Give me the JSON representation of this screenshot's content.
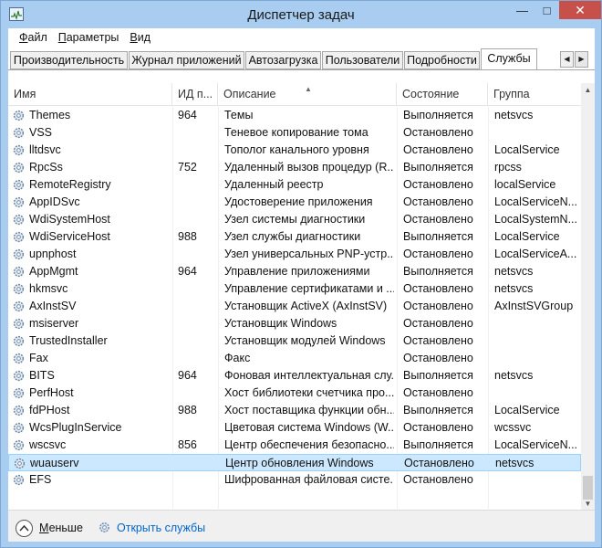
{
  "window": {
    "title": "Диспетчер задач",
    "controls": {
      "minimize": "—",
      "maximize": "□",
      "close": "✕"
    }
  },
  "menu": [
    {
      "u": "Ф",
      "rest": "айл"
    },
    {
      "u": "П",
      "rest": "араметры"
    },
    {
      "u": "В",
      "rest": "ид"
    }
  ],
  "tabs": [
    "Производительность",
    "Журнал приложений",
    "Автозагрузка",
    "Пользователи",
    "Подробности",
    "Службы"
  ],
  "active_tab": "Службы",
  "columns": [
    "Имя",
    "ИД п...",
    "Описание",
    "Состояние",
    "Группа"
  ],
  "rows": [
    {
      "name": "Themes",
      "pid": "964",
      "desc": "Темы",
      "state": "Выполняется",
      "group": "netsvcs"
    },
    {
      "name": "VSS",
      "pid": "",
      "desc": "Теневое копирование тома",
      "state": "Остановлено",
      "group": ""
    },
    {
      "name": "lltdsvc",
      "pid": "",
      "desc": "Тополог канального уровня",
      "state": "Остановлено",
      "group": "LocalService"
    },
    {
      "name": "RpcSs",
      "pid": "752",
      "desc": "Удаленный вызов процедур (R...",
      "state": "Выполняется",
      "group": "rpcss"
    },
    {
      "name": "RemoteRegistry",
      "pid": "",
      "desc": "Удаленный реестр",
      "state": "Остановлено",
      "group": "localService"
    },
    {
      "name": "AppIDSvc",
      "pid": "",
      "desc": "Удостоверение приложения",
      "state": "Остановлено",
      "group": "LocalServiceN..."
    },
    {
      "name": "WdiSystemHost",
      "pid": "",
      "desc": "Узел системы диагностики",
      "state": "Остановлено",
      "group": "LocalSystemN..."
    },
    {
      "name": "WdiServiceHost",
      "pid": "988",
      "desc": "Узел службы диагностики",
      "state": "Выполняется",
      "group": "LocalService"
    },
    {
      "name": "upnphost",
      "pid": "",
      "desc": "Узел универсальных PNP-устр...",
      "state": "Остановлено",
      "group": "LocalServiceA..."
    },
    {
      "name": "AppMgmt",
      "pid": "964",
      "desc": "Управление приложениями",
      "state": "Выполняется",
      "group": "netsvcs"
    },
    {
      "name": "hkmsvc",
      "pid": "",
      "desc": "Управление сертификатами и ...",
      "state": "Остановлено",
      "group": "netsvcs"
    },
    {
      "name": "AxInstSV",
      "pid": "",
      "desc": "Установщик ActiveX (AxInstSV)",
      "state": "Остановлено",
      "group": "AxInstSVGroup"
    },
    {
      "name": "msiserver",
      "pid": "",
      "desc": "Установщик Windows",
      "state": "Остановлено",
      "group": ""
    },
    {
      "name": "TrustedInstaller",
      "pid": "",
      "desc": "Установщик модулей Windows",
      "state": "Остановлено",
      "group": ""
    },
    {
      "name": "Fax",
      "pid": "",
      "desc": "Факс",
      "state": "Остановлено",
      "group": ""
    },
    {
      "name": "BITS",
      "pid": "964",
      "desc": "Фоновая интеллектуальная слу...",
      "state": "Выполняется",
      "group": "netsvcs"
    },
    {
      "name": "PerfHost",
      "pid": "",
      "desc": "Хост библиотеки счетчика про...",
      "state": "Остановлено",
      "group": ""
    },
    {
      "name": "fdPHost",
      "pid": "988",
      "desc": "Хост поставщика функции обн...",
      "state": "Выполняется",
      "group": "LocalService"
    },
    {
      "name": "WcsPlugInService",
      "pid": "",
      "desc": "Цветовая система Windows (W...",
      "state": "Остановлено",
      "group": "wcssvc"
    },
    {
      "name": "wscsvc",
      "pid": "856",
      "desc": "Центр обеспечения безопасно...",
      "state": "Выполняется",
      "group": "LocalServiceN..."
    },
    {
      "name": "wuauserv",
      "pid": "",
      "desc": "Центр обновления Windows",
      "state": "Остановлено",
      "group": "netsvcs",
      "selected": true
    },
    {
      "name": "EFS",
      "pid": "",
      "desc": "Шифрованная файловая систе...",
      "state": "Остановлено",
      "group": ""
    }
  ],
  "footer": {
    "less_u": "М",
    "less_rest": "еньше",
    "open_services": "Открыть службы"
  },
  "colors": {
    "selection": "#cce8ff",
    "selection_border": "#99d1ff",
    "link": "#0066cc",
    "close_button": "#c7504b",
    "frame": "#a9cdf0"
  }
}
